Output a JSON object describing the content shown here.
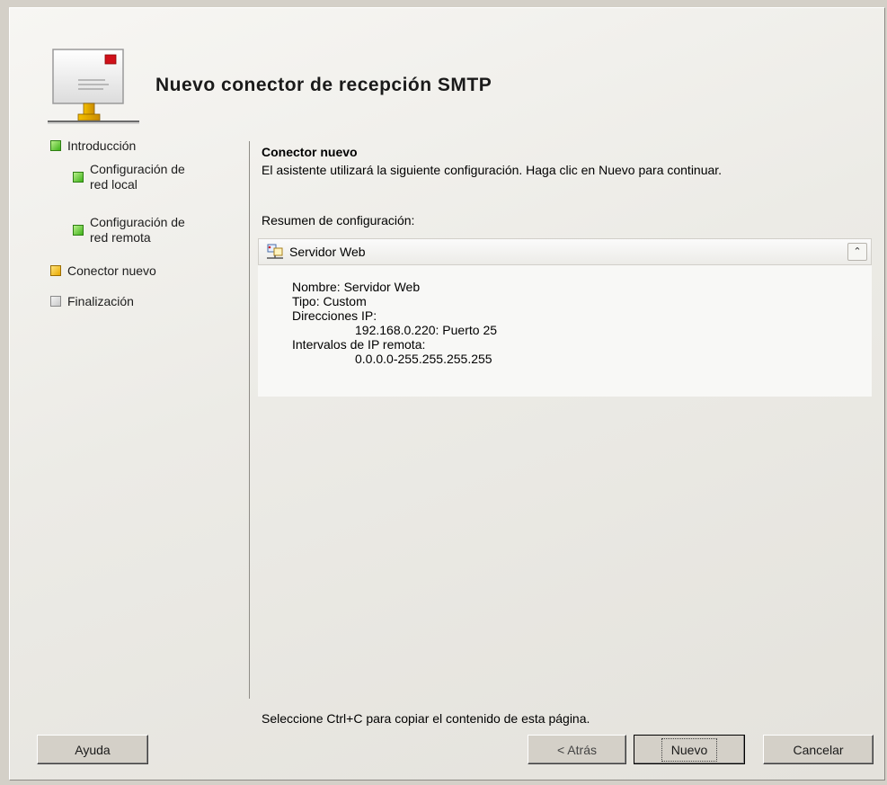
{
  "wizard": {
    "title": "Nuevo conector de recepción SMTP",
    "steps": [
      {
        "label": "Introducción",
        "state": "done"
      },
      {
        "label": "Configuración de\nred local",
        "state": "done"
      },
      {
        "label": "Configuración de\nred remota",
        "state": "done"
      },
      {
        "label": "Conector nuevo",
        "state": "current"
      },
      {
        "label": "Finalización",
        "state": "pending"
      }
    ]
  },
  "content": {
    "heading": "Conector nuevo",
    "intro": "El asistente utilizará la siguiente configuración. Haga clic en Nuevo para continuar.",
    "summary_label": "Resumen de configuración:",
    "summary": {
      "title": "Servidor Web",
      "icon": "server-network-icon",
      "collapse_glyph": "⌃",
      "lines": {
        "name": "Nombre: Servidor Web",
        "type": "Tipo: Custom",
        "ip_label": "Direcciones IP:",
        "ip_value": "192.168.0.220: Puerto 25",
        "remote_label": "Intervalos de IP remota:",
        "remote_value": "0.0.0.0-255.255.255.255"
      }
    },
    "footer_note": "Seleccione Ctrl+C para copiar el contenido de esta página."
  },
  "buttons": {
    "help": "Ayuda",
    "back": "< Atrás",
    "next": "Nuevo",
    "cancel": "Cancelar"
  },
  "colors": {
    "step_done": "#3fb21a",
    "step_current": "#e8a800",
    "step_pending": "#c8c8c8"
  }
}
